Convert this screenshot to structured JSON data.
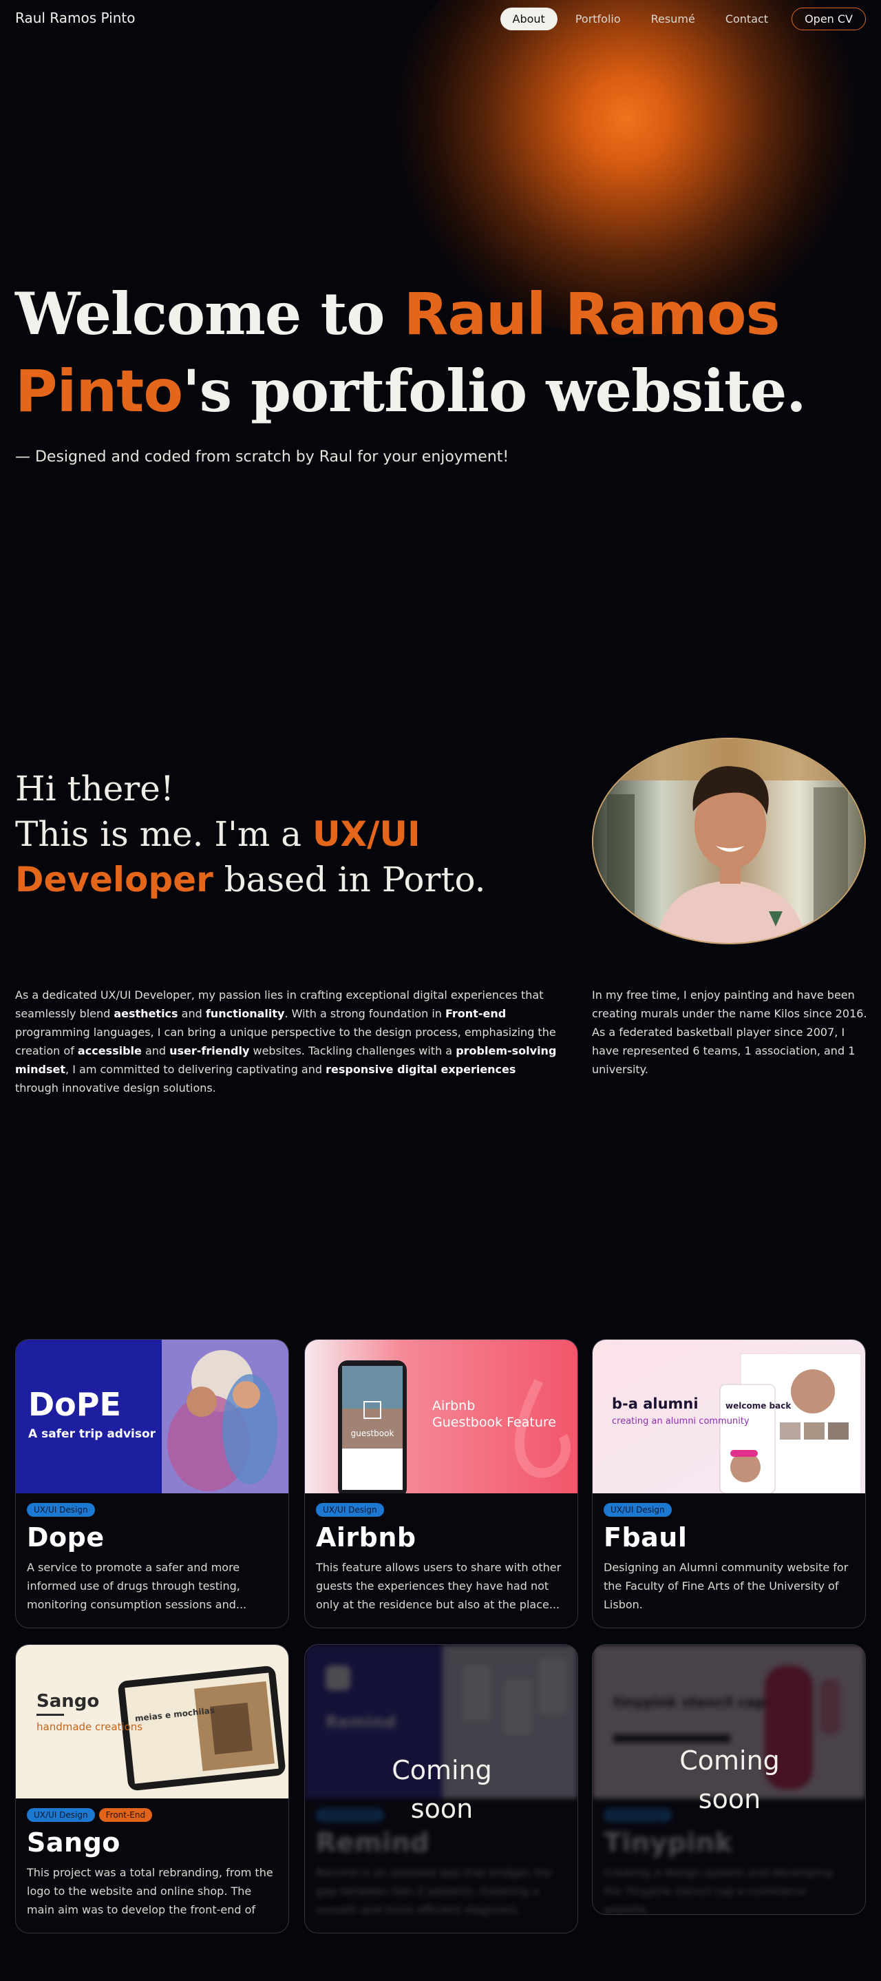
{
  "brand": "Raul Ramos Pinto",
  "nav": {
    "items": [
      {
        "label": "About",
        "active": true
      },
      {
        "label": "Portfolio",
        "active": false
      },
      {
        "label": "Resumé",
        "active": false
      },
      {
        "label": "Contact",
        "active": false
      }
    ],
    "cv_label": "Open CV"
  },
  "hero": {
    "line1_a": "Welcome to ",
    "line1_b": "Raul Ramos",
    "line2_a": "Pinto",
    "line2_b": "'s portfolio website.",
    "tagline": "— Designed and coded from scratch by Raul for your enjoyment!"
  },
  "intro": {
    "line1": "Hi there!",
    "line2_a": "This is me. I'm a ",
    "line2_b": "UX/UI",
    "line3_a": "Developer",
    "line3_b": " based in Porto."
  },
  "about": {
    "left": [
      {
        "t": "As a dedicated UX/UI Developer, my passion lies in crafting exceptional digital experiences that seamlessly blend ",
        "b": false
      },
      {
        "t": "aesthetics",
        "b": true
      },
      {
        "t": " and ",
        "b": false
      },
      {
        "t": "functionality",
        "b": true
      },
      {
        "t": ". With a strong foundation in ",
        "b": false
      },
      {
        "t": "Front-end",
        "b": true
      },
      {
        "t": " programming languages, I can bring a unique perspective to the design process, emphasizing the creation of ",
        "b": false
      },
      {
        "t": "accessible",
        "b": true
      },
      {
        "t": " and ",
        "b": false
      },
      {
        "t": "user-friendly",
        "b": true
      },
      {
        "t": " websites. Tackling challenges with a ",
        "b": false
      },
      {
        "t": "problem-solving mindset",
        "b": true
      },
      {
        "t": ", I am committed to delivering captivating and ",
        "b": false
      },
      {
        "t": "responsive digital experiences",
        "b": true
      },
      {
        "t": " through innovative design solutions.",
        "b": false
      }
    ],
    "right": "In my free time, I enjoy painting and have been creating murals under the name Kilos since 2016. As a federated basketball player since 2007, I have represented 6 teams, 1 association, and 1 university."
  },
  "projects": [
    {
      "title": "Dope",
      "tags": [
        "UX/UI Design"
      ],
      "desc": "A service to promote a safer and more informed use of drugs through testing, monitoring consumption sessions and...",
      "thumb_logo": "DoPE",
      "thumb_sub": "A safer trip advisor",
      "soon": false
    },
    {
      "title": "Airbnb",
      "tags": [
        "UX/UI Design"
      ],
      "desc": "This feature allows users to share with other guests the experiences they have had not only at the residence but also at the place...",
      "thumb_title": "Airbnb",
      "thumb_sub": "Guestbook Feature",
      "thumb_phone": "guestbook",
      "soon": false
    },
    {
      "title": "Fbaul",
      "tags": [
        "UX/UI Design"
      ],
      "desc": "Designing an Alumni community website for the Faculty of Fine Arts of the University of Lisbon.",
      "thumb_title": "b-a alumni",
      "thumb_sub": "creating an alumni community",
      "thumb_welcome": "welcome back",
      "soon": false
    },
    {
      "title": "Sango",
      "tags": [
        "UX/UI Design",
        "Front-End"
      ],
      "desc": "This project was a total rebranding, from the logo to the website and online shop. The main aim was to develop the front-end of th...",
      "thumb_title": "Sango",
      "thumb_sub": "handmade creations",
      "thumb_screen": "meias e mochilas",
      "soon": false
    },
    {
      "title": "Remind",
      "tags": [
        "UX/UI Design"
      ],
      "desc": "Remind is an assisted app that bridges the gap between Gen Z patients, fostering a smooth and more efficient diagnosis.",
      "thumb_title": "Remind",
      "soon": true,
      "soon_label": "Coming soon"
    },
    {
      "title": "Tinypink",
      "tags": [
        "UX/UI Design"
      ],
      "desc": "Creating a design system and developing the Tinypink stencil cap e-commerce website.",
      "thumb_title": "tinypink stencil cap",
      "soon": true,
      "soon_label": "Coming soon"
    }
  ],
  "colors": {
    "accent": "#e4661b",
    "bg": "#05050c",
    "tag_ux": "#1d78d2",
    "tag_fe": "#e0641a"
  }
}
